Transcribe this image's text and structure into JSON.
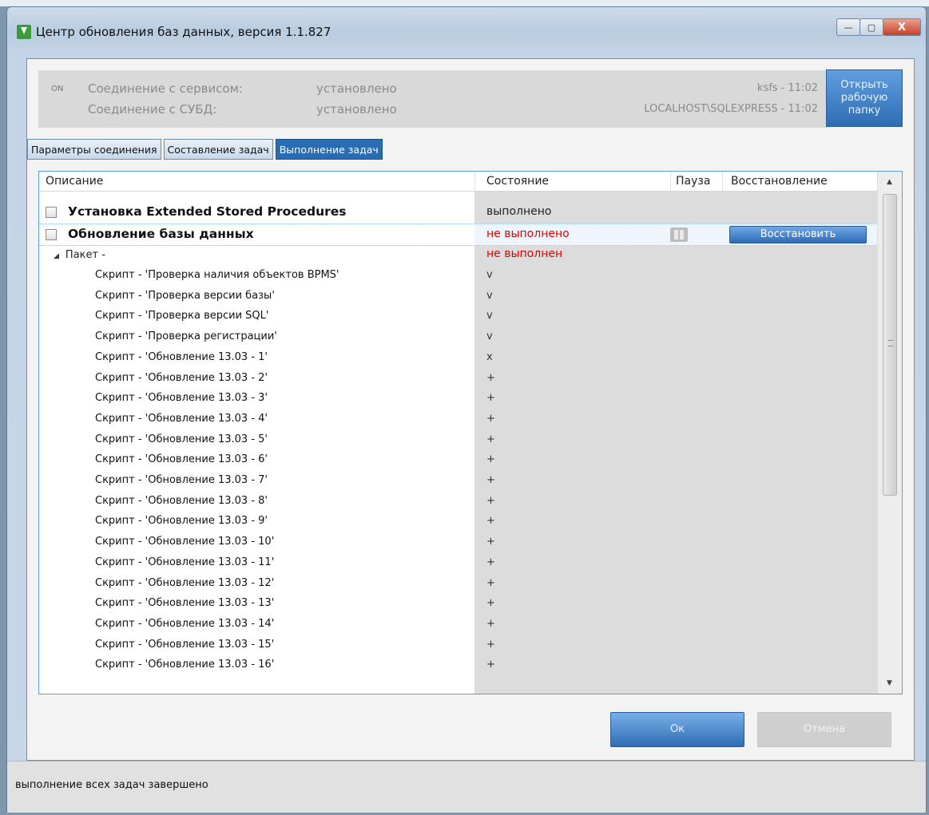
{
  "window": {
    "title": "Центр обновления баз данных, версия 1.1.827",
    "controls": {
      "minimize": "—",
      "maximize": "▢",
      "close": "X"
    }
  },
  "connection": {
    "badge": "ON",
    "service_label": "Соединение с сервисом:",
    "service_value": "установлено",
    "service_right": "ksfs - 11:02",
    "db_label": "Соединение с СУБД:",
    "db_value": "установлено",
    "db_right": "LOCALHOST\\SQLEXPRESS - 11:02",
    "open_folder_button": "Открыть рабочую папку"
  },
  "tabs": [
    {
      "label": "Параметры соединения",
      "active": false
    },
    {
      "label": "Составление задач",
      "active": false
    },
    {
      "label": "Выполнение задач",
      "active": true
    }
  ],
  "grid": {
    "columns": [
      "Описание",
      "Состояние",
      "Пауза",
      "Восстановление"
    ],
    "tasks": [
      {
        "label": "Установка Extended Stored Procedures",
        "state": "выполнено"
      },
      {
        "label": "Обновление базы данных",
        "state": "не выполнено",
        "restore_label": "Восстановить"
      }
    ],
    "package": {
      "label": "Пакет -",
      "state": "не выполнен"
    },
    "scripts": [
      {
        "label": "Скрипт - 'Проверка наличия объектов BPMS'",
        "state": "v"
      },
      {
        "label": "Скрипт - 'Проверка версии базы'",
        "state": "v"
      },
      {
        "label": "Скрипт - 'Проверка версии SQL'",
        "state": "v"
      },
      {
        "label": "Скрипт - 'Проверка регистрации'",
        "state": "v"
      },
      {
        "label": "Скрипт - 'Обновление 13.03 - 1'",
        "state": "x"
      },
      {
        "label": "Скрипт - 'Обновление 13.03 - 2'",
        "state": "+"
      },
      {
        "label": "Скрипт - 'Обновление 13.03 - 3'",
        "state": "+"
      },
      {
        "label": "Скрипт - 'Обновление 13.03 - 4'",
        "state": "+"
      },
      {
        "label": "Скрипт - 'Обновление 13.03 - 5'",
        "state": "+"
      },
      {
        "label": "Скрипт - 'Обновление 13.03 - 6'",
        "state": "+"
      },
      {
        "label": "Скрипт - 'Обновление 13.03 - 7'",
        "state": "+"
      },
      {
        "label": "Скрипт - 'Обновление 13.03 - 8'",
        "state": "+"
      },
      {
        "label": "Скрипт - 'Обновление 13.03 - 9'",
        "state": "+"
      },
      {
        "label": "Скрипт - 'Обновление 13.03 - 10'",
        "state": "+"
      },
      {
        "label": "Скрипт - 'Обновление 13.03 - 11'",
        "state": "+"
      },
      {
        "label": "Скрипт - 'Обновление 13.03 - 12'",
        "state": "+"
      },
      {
        "label": "Скрипт - 'Обновление 13.03 - 13'",
        "state": "+"
      },
      {
        "label": "Скрипт - 'Обновление 13.03 - 14'",
        "state": "+"
      },
      {
        "label": "Скрипт - 'Обновление 13.03 - 15'",
        "state": "+"
      },
      {
        "label": "Скрипт - 'Обновление 13.03 - 16'",
        "state": "+"
      }
    ]
  },
  "buttons": {
    "ok": "Ок",
    "cancel": "Отмена"
  },
  "status": "выполнение всех задач завершено",
  "colors": {
    "accent": "#2a6cb4",
    "error": "#e00000"
  },
  "icons": {
    "app": "download-arrow-icon",
    "pause": "pause-icon",
    "expand": "triangle-expanded-icon"
  }
}
